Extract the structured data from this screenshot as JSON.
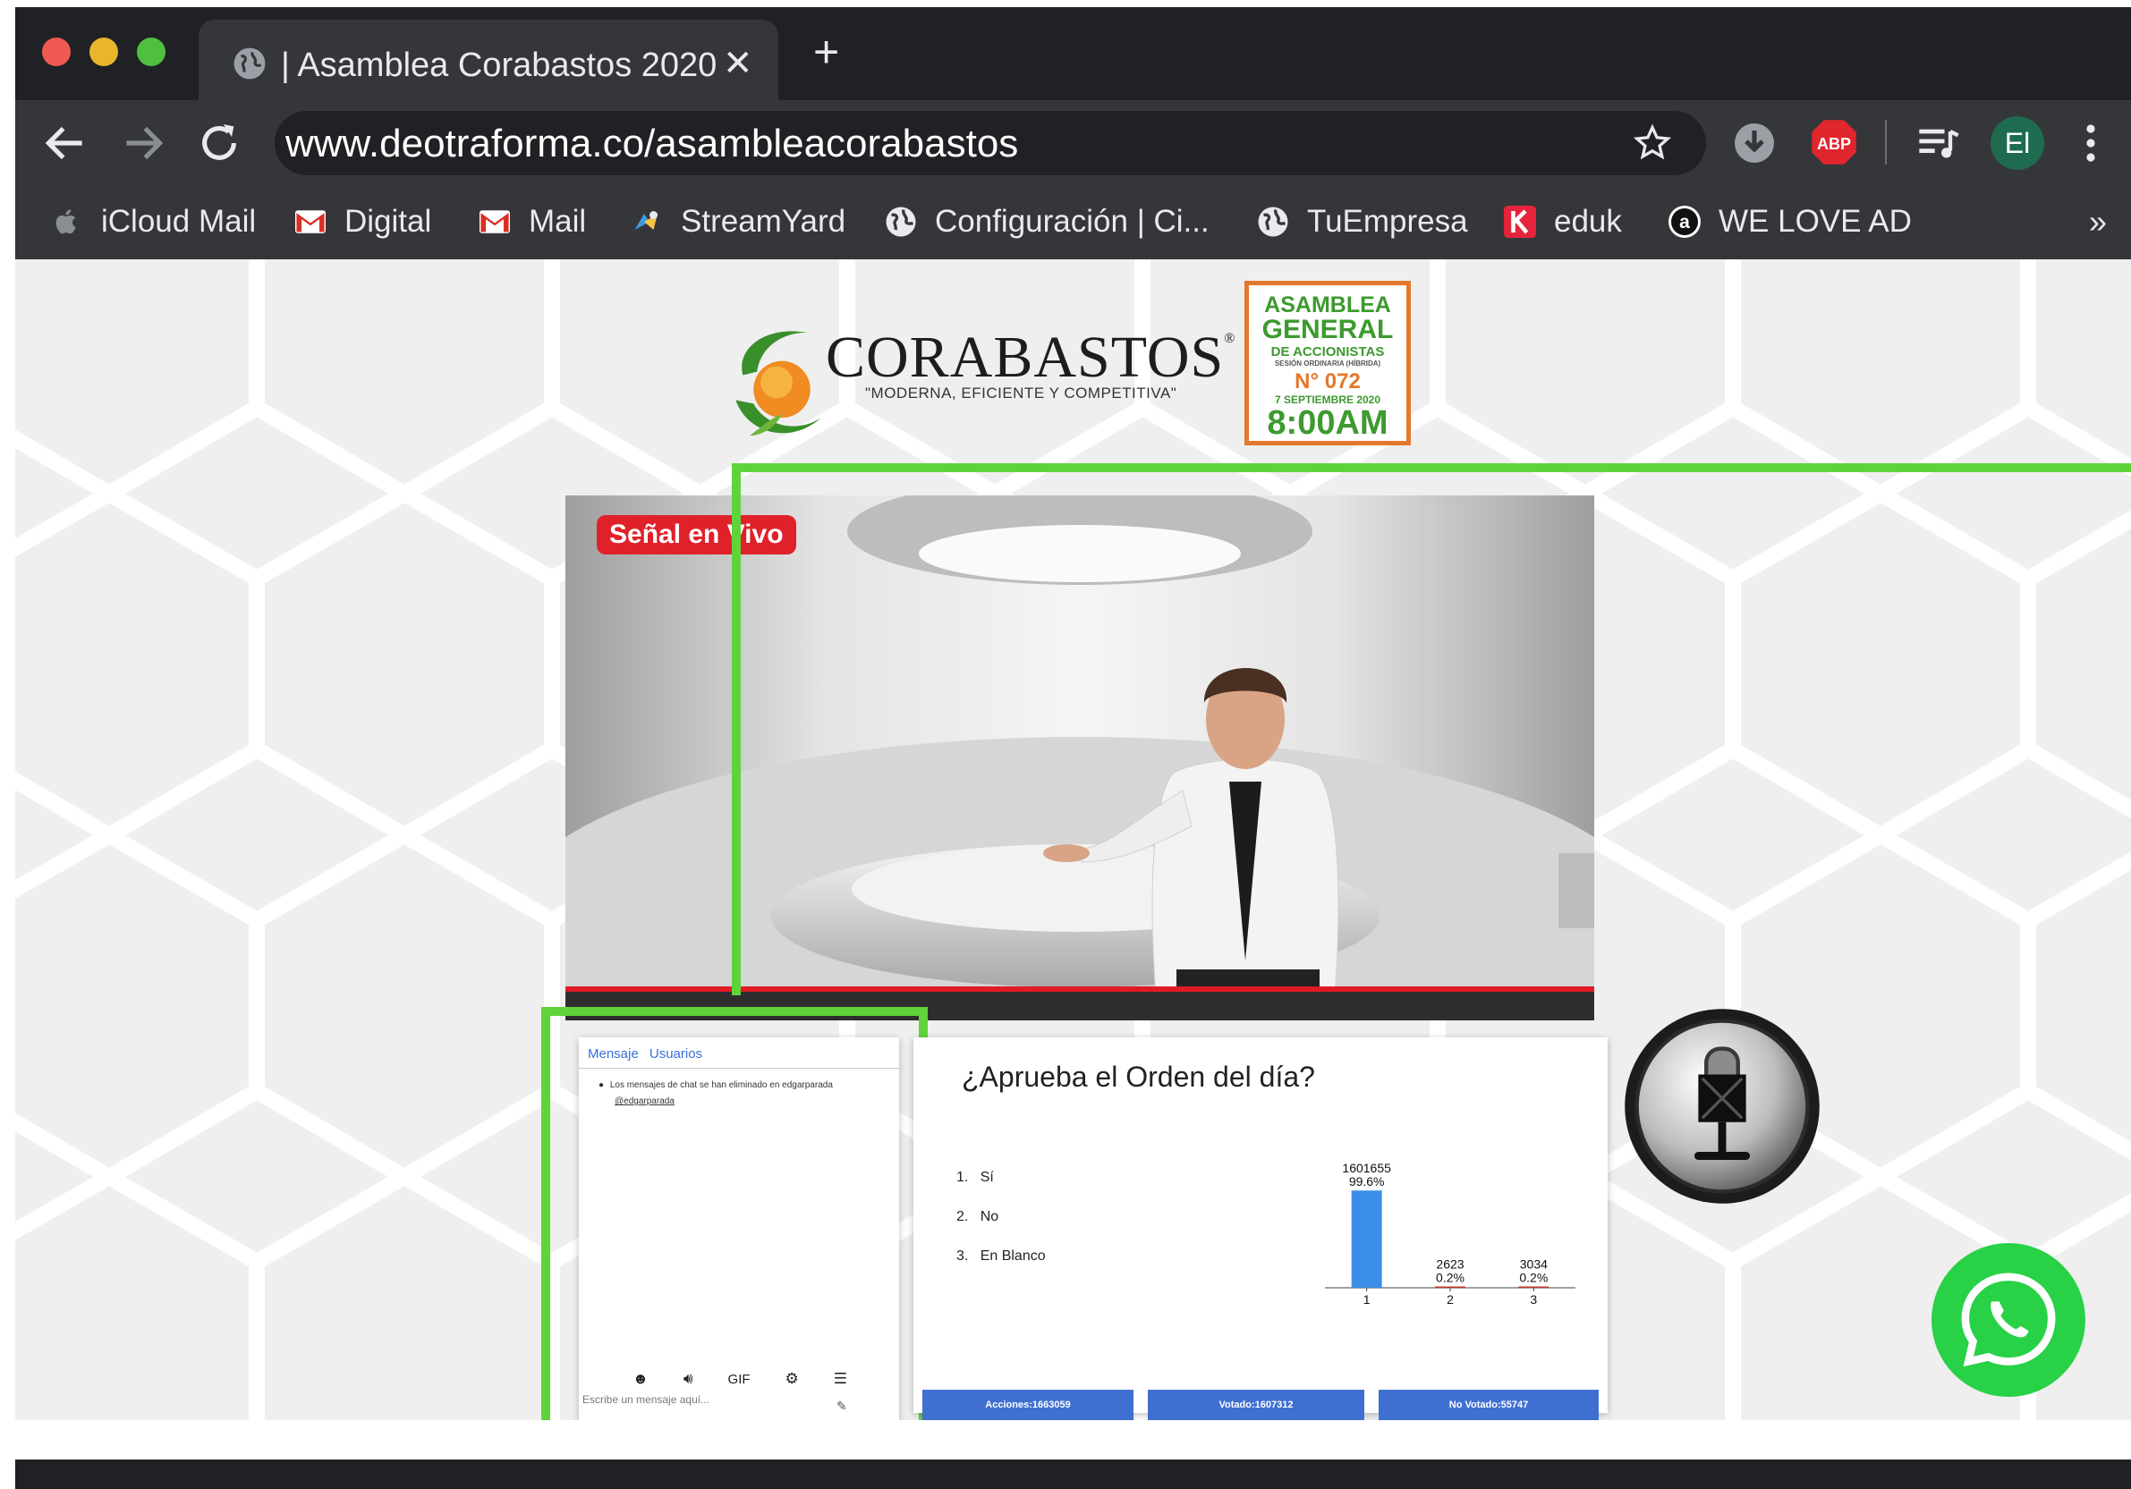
{
  "browser": {
    "tab_title": "| Asamblea Corabastos 2020",
    "tab_close": "✕",
    "new_tab": "+",
    "url": "www.deotraforma.co/asambleacorabastos",
    "profile_initials": "El",
    "adblock_label": "ABP",
    "bookmarks_overflow": "»",
    "bookmarks": [
      {
        "label": "iCloud Mail",
        "icon": "apple-icon"
      },
      {
        "label": "Digital",
        "icon": "gmail-icon"
      },
      {
        "label": "Mail",
        "icon": "gmail-icon"
      },
      {
        "label": "StreamYard",
        "icon": "streamyard-icon"
      },
      {
        "label": "Configuración | Ci...",
        "icon": "globe-icon"
      },
      {
        "label": "TuEmpresa",
        "icon": "globe-icon"
      },
      {
        "label": "eduk",
        "icon": "eduk-icon"
      },
      {
        "label": "WE LOVE AD",
        "icon": "amazon-icon"
      }
    ]
  },
  "header": {
    "brand_name": "CORABASTOS",
    "brand_mark": "®",
    "brand_tagline": "\"MODERNA, EFICIENTE Y COMPETITIVA\"",
    "event_badge": {
      "line1": "ASAMBLEA",
      "line2": "GENERAL",
      "line3": "DE ACCIONISTAS",
      "line4": "SESIÓN ORDINARIA (HÍBRIDA)",
      "line5": "N° 072",
      "line6": "7 SEPTIEMBRE 2020",
      "line7": "8:00AM"
    }
  },
  "video": {
    "live_badge": "Señal en Vivo"
  },
  "chat": {
    "tab_message": "Mensaje",
    "tab_users": "Usuarios",
    "notice": "Los mensajes de chat se han eliminado en edgarparada",
    "notice_user": "@edgarparada",
    "gif_label": "GIF",
    "input_placeholder": "Escribe un mensaje aquí..."
  },
  "poll": {
    "question": "¿Aprueba el Orden del día?",
    "options": [
      {
        "num": "1.",
        "label": "Sí"
      },
      {
        "num": "2.",
        "label": "No"
      },
      {
        "num": "3.",
        "label": "En Blanco"
      }
    ],
    "footer": {
      "acciones": "Acciones:1663059",
      "votado": "Votado:1607312",
      "no_votado": "No Votado:55747"
    }
  },
  "chart_data": {
    "type": "bar",
    "categories": [
      "1",
      "2",
      "3"
    ],
    "values": [
      1601655,
      2623,
      3034
    ],
    "percent_labels": [
      "99.6%",
      "0.2%",
      "0.2%"
    ],
    "value_labels": [
      "1601655",
      "2623",
      "3034"
    ],
    "title": "",
    "xlabel": "",
    "ylabel": "",
    "ylim": [
      0,
      1620000
    ],
    "grid": false,
    "colors": [
      "#3b8ee8",
      "#c0392b",
      "#c0392b"
    ]
  },
  "colors": {
    "highlight_green": "#5fd43a",
    "live_red": "#e0212a",
    "whatsapp_green": "#28d146",
    "badge_orange": "#e4782d",
    "badge_green": "#3d9a2f",
    "footer_blue": "#3f6fd0"
  }
}
